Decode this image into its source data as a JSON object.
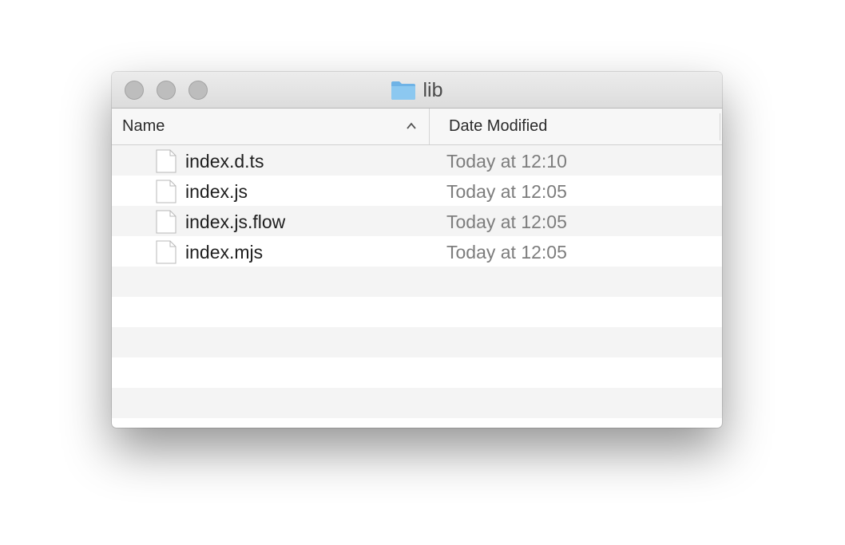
{
  "window": {
    "title": "lib",
    "title_icon": "folder-icon"
  },
  "columns": {
    "name": "Name",
    "date_modified": "Date Modified",
    "sort_indicator": "chevron-up-icon"
  },
  "files": [
    {
      "name": "index.d.ts",
      "date": "Today at 12:10",
      "icon": "file-icon"
    },
    {
      "name": "index.js",
      "date": "Today at 12:05",
      "icon": "file-icon"
    },
    {
      "name": "index.js.flow",
      "date": "Today at 12:05",
      "icon": "file-icon"
    },
    {
      "name": "index.mjs",
      "date": "Today at 12:05",
      "icon": "file-icon"
    }
  ],
  "colors": {
    "folder": "#8cc8f0",
    "traffic_light_inactive": "#bdbdbd",
    "date_text": "#7d7d7d"
  }
}
